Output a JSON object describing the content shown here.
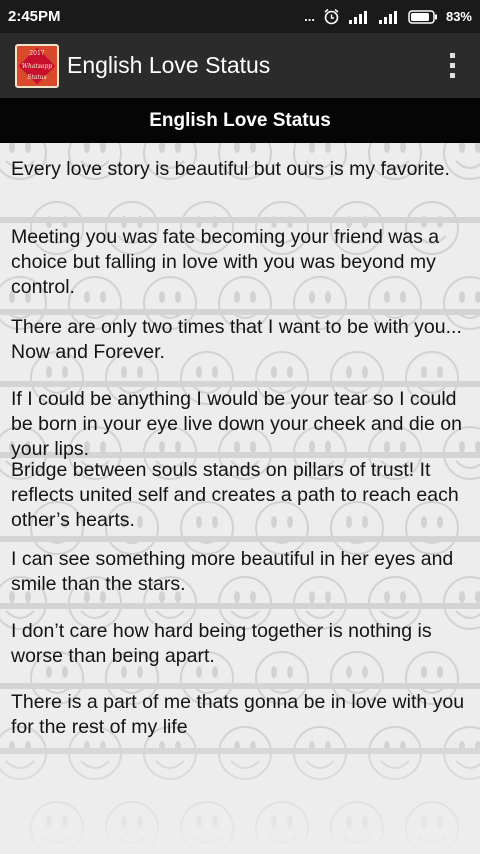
{
  "status_bar": {
    "time": "2:45PM",
    "dots": "...",
    "battery": "83%"
  },
  "app_bar": {
    "icon_text": [
      "2017",
      "Whatsapp",
      "Status"
    ],
    "title": "English Love Status"
  },
  "section_header": "English Love Status",
  "items": [
    "Every love story is beautiful but ours is my favorite.",
    "Meeting you was fate becoming your friend was a choice but falling in love with you was beyond my control.",
    "There are only two times that I want to be with you... Now and Forever.",
    "If I could be anything I would be your tear so I could be born in your eye live down your cheek and die on your lips.",
    "Bridge between souls stands on pillars of trust! It reflects united self and creates a path to reach each other’s hearts.",
    "I can see something more beautiful in her eyes and smile than the stars.",
    "I don’t care how hard being together is nothing is worse than being apart.",
    "There is a part of me thats gonna be in love with you for the rest of my life"
  ],
  "colors": {
    "status_bar": "#1a1a1a",
    "app_bar": "#2b2b2b",
    "section_header": "#050505",
    "list_background": "#ededed",
    "divider": "#d4d4d4",
    "icon_red": "#c8102e"
  },
  "icons": [
    "alarm-icon",
    "signal-icon",
    "battery-icon",
    "overflow-menu-icon",
    "smiley-pattern"
  ]
}
